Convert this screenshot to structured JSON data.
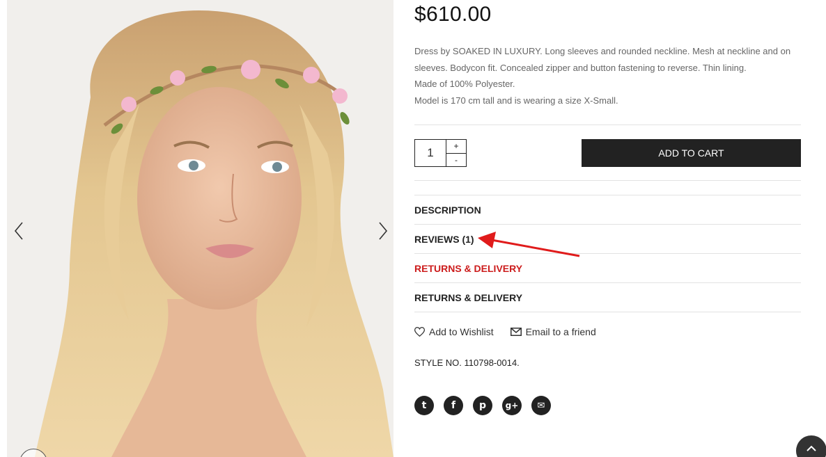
{
  "product": {
    "price": "$610.00",
    "description": [
      "Dress by SOAKED IN LUXURY. Long sleeves and rounded neckline. Mesh at neckline and on sleeves. Bodycon fit. Concealed zipper and button fastening to reverse. Thin lining.",
      "Made of 100% Polyester.",
      "Model is 170 cm tall and is wearing a size X-Small."
    ],
    "style_no": "STYLE NO. 110798-0014."
  },
  "cart": {
    "quantity": "1",
    "plus_label": "+",
    "minus_label": "-",
    "add_label": "ADD TO CART"
  },
  "tabs": [
    {
      "label": "DESCRIPTION",
      "active": false
    },
    {
      "label": "REVIEWS (1)",
      "active": false
    },
    {
      "label": "RETURNS & DELIVERY",
      "active": true
    },
    {
      "label": "RETURNS & DELIVERY",
      "active": false
    }
  ],
  "links": {
    "wishlist": "Add to Wishlist",
    "email": "Email to a friend"
  },
  "social": [
    {
      "icon": "twitter-icon",
      "glyph": "t"
    },
    {
      "icon": "facebook-icon",
      "glyph": "f"
    },
    {
      "icon": "pinterest-icon",
      "glyph": "p"
    },
    {
      "icon": "google-plus-icon",
      "glyph": "g+"
    },
    {
      "icon": "email-share-icon",
      "glyph": "✉"
    }
  ],
  "colors": {
    "active_tab": "#cc1c1c",
    "button_bg": "#222222",
    "annotation_arrow": "#e01b1b"
  }
}
